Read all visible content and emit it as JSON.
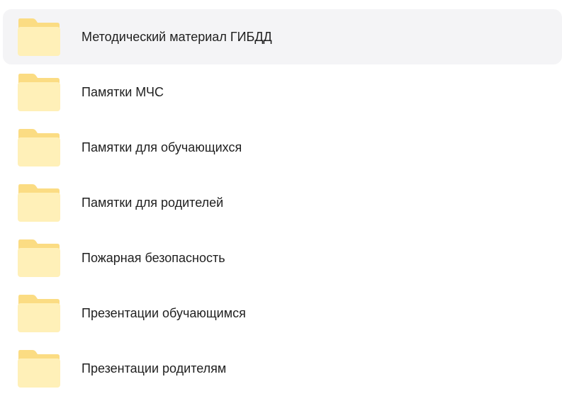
{
  "folders": [
    {
      "label": "Методический материал ГИБДД",
      "icon": "folder-icon",
      "hovered": true
    },
    {
      "label": "Памятки МЧС",
      "icon": "folder-icon"
    },
    {
      "label": "Памятки для обучающихся",
      "icon": "folder-icon"
    },
    {
      "label": "Памятки для родителей",
      "icon": "folder-icon"
    },
    {
      "label": "Пожарная безопасность",
      "icon": "folder-icon"
    },
    {
      "label": "Презентации обучающимся",
      "icon": "folder-icon"
    },
    {
      "label": "Презентации родителям",
      "icon": "folder-icon"
    }
  ],
  "colors": {
    "folder_back": "#fde79a",
    "folder_front": "#fff0b8",
    "hover_bg": "#f4f4f6",
    "text": "#1f1f1f"
  }
}
